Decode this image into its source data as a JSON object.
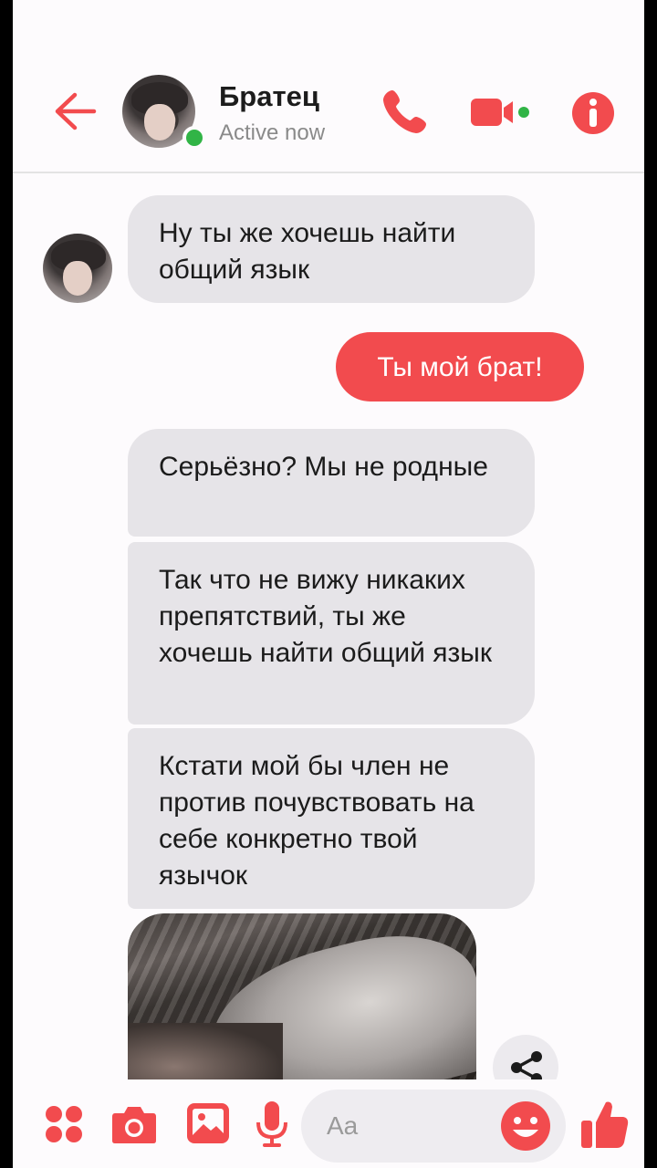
{
  "header": {
    "contact_name": "Братец",
    "status": "Active now"
  },
  "messages": [
    {
      "direction": "incoming",
      "text": "Ну ты же хочешь найти общий язык"
    },
    {
      "direction": "outgoing",
      "text": "Ты мой брат!"
    },
    {
      "direction": "incoming",
      "text": "Серьёзно? Мы не родные"
    },
    {
      "direction": "incoming",
      "text": "Так что не вижу никаких препятствий, ты же хочешь найти общий язык"
    },
    {
      "direction": "incoming",
      "text": "Кстати мой бы член не против почувствовать на себе конкретно твой язычок"
    },
    {
      "direction": "incoming",
      "type": "photo"
    }
  ],
  "composer": {
    "placeholder": "Aa"
  },
  "colors": {
    "accent": "#f24b4e",
    "incoming_bubble": "#e6e4e8",
    "online": "#31b446"
  },
  "icons": [
    "back-arrow-icon",
    "phone-icon",
    "video-camera-icon",
    "info-icon",
    "share-icon",
    "apps-icon",
    "camera-icon",
    "gallery-icon",
    "microphone-icon",
    "emoji-icon",
    "thumbs-up-icon"
  ]
}
